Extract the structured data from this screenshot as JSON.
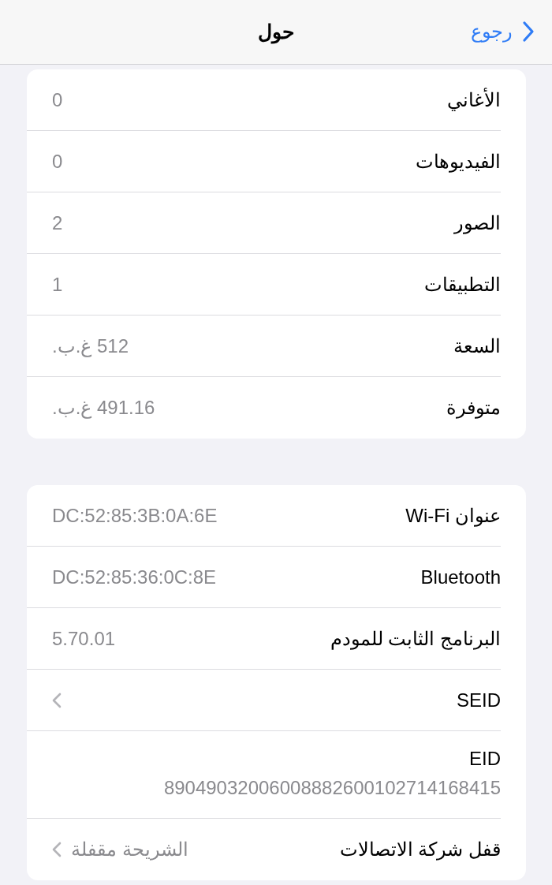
{
  "nav": {
    "back": "رجوع",
    "title": "حول"
  },
  "sections": [
    {
      "rows": [
        {
          "kind": "value",
          "label": "الأغاني",
          "value": "0"
        },
        {
          "kind": "value",
          "label": "الفيديوهات",
          "value": "0"
        },
        {
          "kind": "value",
          "label": "الصور",
          "value": "2"
        },
        {
          "kind": "value",
          "label": "التطبيقات",
          "value": "1"
        },
        {
          "kind": "value",
          "label": "السعة",
          "value": "512 غ.ب."
        },
        {
          "kind": "value",
          "label": "متوفرة",
          "value": "491.16 غ.ب."
        }
      ]
    },
    {
      "rows": [
        {
          "kind": "value",
          "label": "عنوان Wi-Fi",
          "value": "DC:52:85:3B:0A:6E"
        },
        {
          "kind": "value",
          "label": "Bluetooth",
          "value": "DC:52:85:36:0C:8E"
        },
        {
          "kind": "value",
          "label": "البرنامج الثابت للمودم",
          "value": "5.70.01"
        },
        {
          "kind": "link",
          "label": "SEID"
        },
        {
          "kind": "stacked",
          "label": "EID",
          "value": "89049032006008882600102714168415"
        },
        {
          "kind": "link",
          "label": "قفل شركة الاتصالات",
          "value": "الشريحة مقفلة"
        }
      ]
    }
  ]
}
